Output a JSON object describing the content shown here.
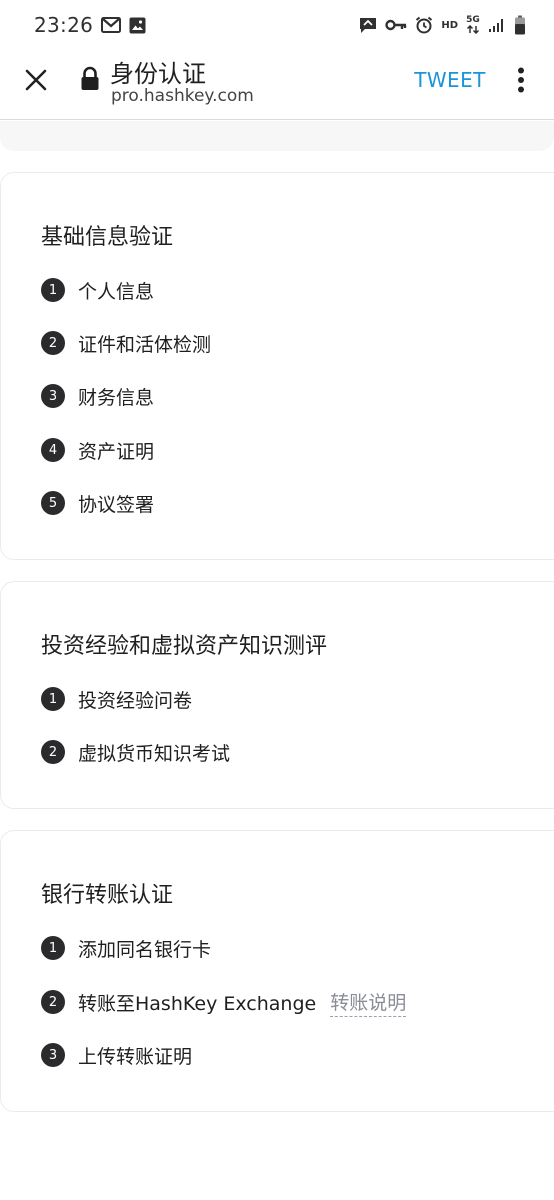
{
  "status_bar": {
    "time": "23:26",
    "icons_left": [
      "gmail-icon",
      "image-icon"
    ],
    "icons_right": [
      "message-icon",
      "vpn-key-icon",
      "alarm-icon",
      "hd-icon",
      "5g-icon",
      "signal-icon",
      "battery-icon"
    ],
    "hd_label": "HD",
    "network_label": "5G"
  },
  "toolbar": {
    "title": "身份认证",
    "url": "pro.hashkey.com",
    "tweet_label": "TWEET",
    "accent_color": "#1a95d8"
  },
  "sections": [
    {
      "title": "基础信息验证",
      "steps": [
        {
          "num": "1",
          "label": "个人信息"
        },
        {
          "num": "2",
          "label": "证件和活体检测"
        },
        {
          "num": "3",
          "label": "财务信息"
        },
        {
          "num": "4",
          "label": "资产证明"
        },
        {
          "num": "5",
          "label": "协议签署"
        }
      ]
    },
    {
      "title": "投资经验和虚拟资产知识测评",
      "steps": [
        {
          "num": "1",
          "label": "投资经验问卷"
        },
        {
          "num": "2",
          "label": "虚拟货币知识考试"
        }
      ]
    },
    {
      "title": "银行转账认证",
      "steps": [
        {
          "num": "1",
          "label": "添加同名银行卡"
        },
        {
          "num": "2",
          "label": "转账至HashKey Exchange",
          "link": "转账说明"
        },
        {
          "num": "3",
          "label": "上传转账证明"
        }
      ]
    }
  ]
}
